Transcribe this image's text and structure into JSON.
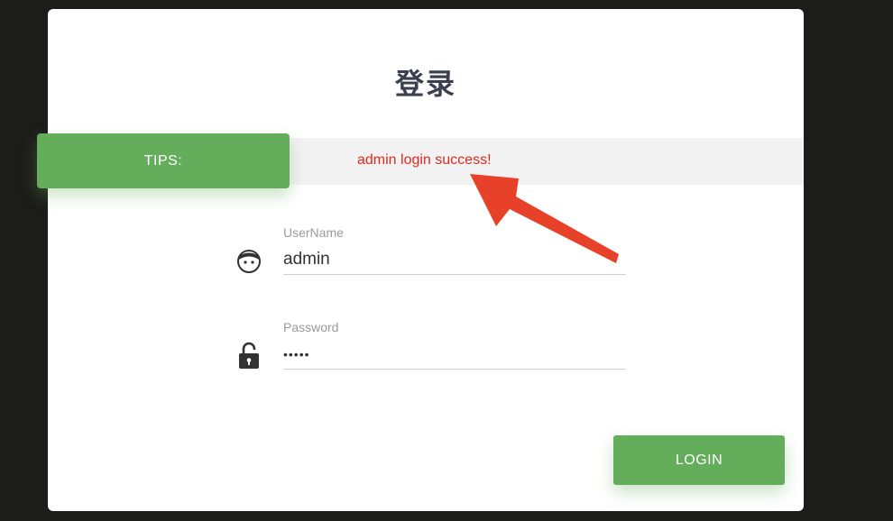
{
  "login": {
    "title": "登录",
    "tips_label": "TIPS:",
    "tips_message": "admin login success!",
    "username": {
      "label": "UserName",
      "value": "admin"
    },
    "password": {
      "label": "Password",
      "value": "•••••"
    },
    "submit_label": "LOGIN"
  },
  "colors": {
    "accent_green": "#63ad5b",
    "tips_red": "#e02a1e",
    "annotation_arrow": "#e8412a",
    "background": "#1c1c18"
  },
  "icons": {
    "username": "face-icon",
    "password": "unlock-icon",
    "annotation": "arrow-icon"
  }
}
